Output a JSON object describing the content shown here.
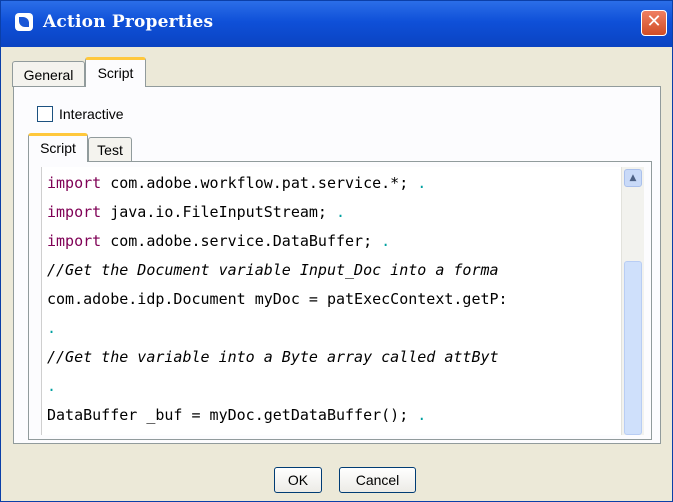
{
  "window": {
    "title": "Action Properties"
  },
  "tabs": [
    {
      "label": "General",
      "active": false
    },
    {
      "label": "Script",
      "active": true
    }
  ],
  "script_panel": {
    "interactive": {
      "label": "Interactive",
      "checked": false
    },
    "subtabs": [
      {
        "label": "Script",
        "active": true
      },
      {
        "label": "Test",
        "active": false
      }
    ]
  },
  "editor": {
    "lines": [
      {
        "keyword": "import",
        "text": " com.adobe.workflow.pat.service.*;",
        "trail": " ."
      },
      {
        "keyword": "import",
        "text": " java.io.FileInputStream;",
        "trail": " ."
      },
      {
        "keyword": "import",
        "text": " com.adobe.service.DataBuffer;",
        "trail": " ."
      },
      {
        "comment": "//Get the Document variable Input_Doc into a forma"
      },
      {
        "text": "com.adobe.idp.Document myDoc = patExecContext.getP:"
      },
      {
        "trail": "."
      },
      {
        "comment": "//Get the variable into a Byte array called attByt"
      },
      {
        "trail": "."
      },
      {
        "text": "DataBuffer _buf = myDoc.getDataBuffer();",
        "trail": " ."
      }
    ]
  },
  "buttons": {
    "ok": "OK",
    "cancel": "Cancel"
  },
  "colors": {
    "title_bar": "#0f50d8",
    "keyword": "#7f0055",
    "active_tab_accent": "#ffc83c",
    "close_button": "#d14d26"
  },
  "icons": {
    "app": "adobe-app-icon",
    "close": "close-icon",
    "scroll_up": "scroll-up-arrow-icon"
  }
}
